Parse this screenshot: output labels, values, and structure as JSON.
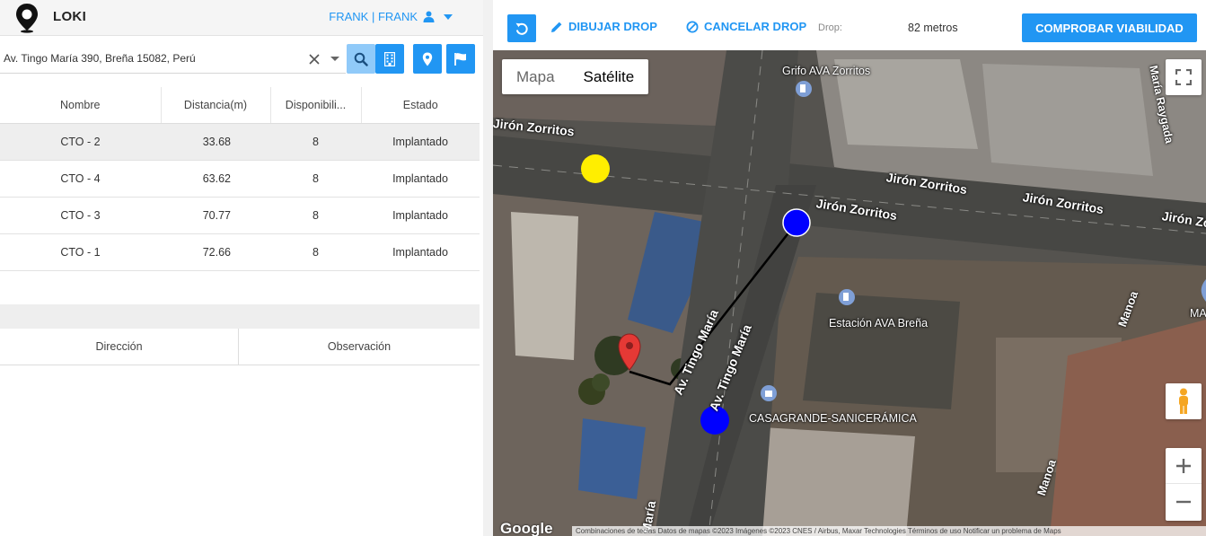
{
  "header": {
    "app_title": "LOKI",
    "user_label": "FRANK | FRANK",
    "icons": {
      "logo": "map-pin-logo-icon",
      "user": "user-icon",
      "caret": "caret-down-icon"
    }
  },
  "search": {
    "value": "Av. Tingo María 390, Breña 15082, Perú",
    "placeholder": "",
    "icons": [
      "close-icon",
      "dropdown-icon",
      "search-icon",
      "building-icon",
      "map-marker-icon",
      "flag-icon"
    ]
  },
  "cto_table": {
    "headers": [
      "Nombre",
      "Distancia(m)",
      "Disponibili...",
      "Estado"
    ],
    "rows": [
      {
        "nombre": "CTO - 2",
        "distancia": "33.68",
        "disponibilidad": "8",
        "estado": "Implantado",
        "selected": true
      },
      {
        "nombre": "CTO - 4",
        "distancia": "63.62",
        "disponibilidad": "8",
        "estado": "Implantado"
      },
      {
        "nombre": "CTO - 3",
        "distancia": "70.77",
        "disponibilidad": "8",
        "estado": "Implantado"
      },
      {
        "nombre": "CTO - 1",
        "distancia": "72.66",
        "disponibilidad": "8",
        "estado": "Implantado"
      }
    ]
  },
  "detail_table": {
    "headers": [
      "Dirección",
      "Observación"
    ]
  },
  "toolbar": {
    "draw_label": "DIBUJAR DROP",
    "cancel_label": "CANCELAR DROP",
    "drop_label": "Drop:",
    "drop_value": "82 metros",
    "check_label": "COMPROBAR VIABILIDAD",
    "icons": {
      "reset": "undo-icon",
      "draw": "pencil-icon",
      "cancel": "block-icon"
    }
  },
  "map": {
    "type_tabs": [
      "Mapa",
      "Satélite"
    ],
    "active_tab": "Satélite",
    "street_labels": [
      "Jirón Zorritos",
      "Jirón Zorritos",
      "Jirón Zorritos",
      "Jirón Zorritos",
      "Jirón Zo",
      "María Raygada",
      "Av. Tingo María",
      "Av. Tingo María",
      "María",
      "Manoa",
      "Manoa"
    ],
    "poi_labels": [
      "Grifo AVA Zorritos",
      "Estación AVA Breña",
      "CASAGRANDE-SANICERÁMICA",
      "MA"
    ],
    "google_logo": "Google",
    "attribution": "Combinaciones de teclas   Datos de mapas ©2023 Imágenes ©2023 CNES / Airbus, Maxar Technologies   Términos de uso   Notificar un problema de Maps",
    "colors": {
      "yellow_marker": "#ffee00",
      "blue_marker": "#0000ff",
      "red_pin": "#e53935",
      "accent": "#2196f3"
    }
  }
}
